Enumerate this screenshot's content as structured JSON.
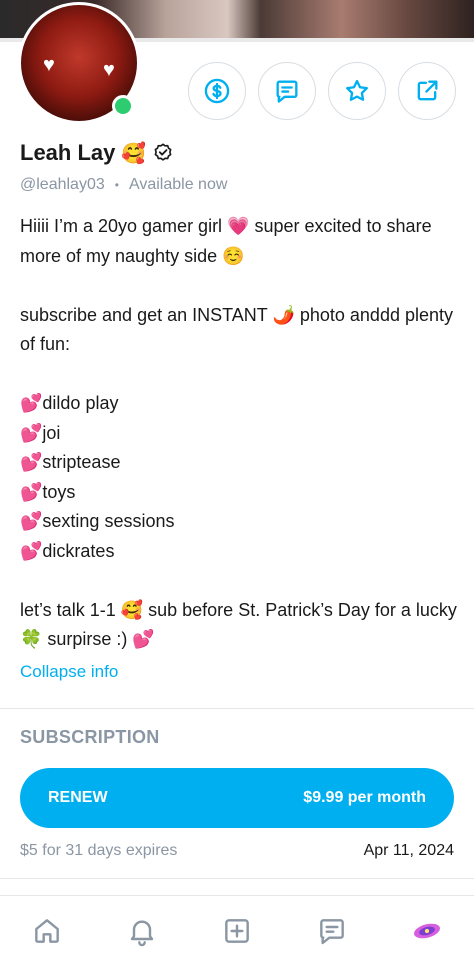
{
  "profile": {
    "name": "Leah Lay",
    "name_emoji": "🥰",
    "handle": "@leahlay03",
    "separator": "•",
    "status": "Available now"
  },
  "actions": [
    {
      "icon": "dollar-icon"
    },
    {
      "icon": "message-icon"
    },
    {
      "icon": "star-icon"
    },
    {
      "icon": "share-icon"
    }
  ],
  "bio": {
    "line1": "Hiiii I’m a 20yo gamer girl 💗 super excited to share more of my naughty side ☺️",
    "line2": "subscribe and get an INSTANT 🌶️ photo anddd plenty of fun:",
    "items": [
      "💕dildo play",
      "💕joi",
      "💕striptease",
      "💕toys",
      "💕sexting sessions",
      "💕dickrates"
    ],
    "line3": "let’s talk 1-1 🥰 sub before St. Patrick’s Day for a lucky 🍀 surpirse :) 💕"
  },
  "collapse_label": "Collapse info",
  "subscription": {
    "title": "SUBSCRIPTION",
    "renew_label": "RENEW",
    "price": "$9.99 per month",
    "expire_label": "$5 for 31 days expires",
    "expire_date": "Apr 11, 2024"
  },
  "colors": {
    "accent": "#00aff0",
    "muted": "#8a96a3",
    "online": "#2ecc71"
  },
  "tabs": [
    {
      "icon": "home-icon"
    },
    {
      "icon": "bell-icon"
    },
    {
      "icon": "add-post-icon"
    },
    {
      "icon": "messages-icon"
    },
    {
      "icon": "profile-avatar-icon"
    }
  ]
}
